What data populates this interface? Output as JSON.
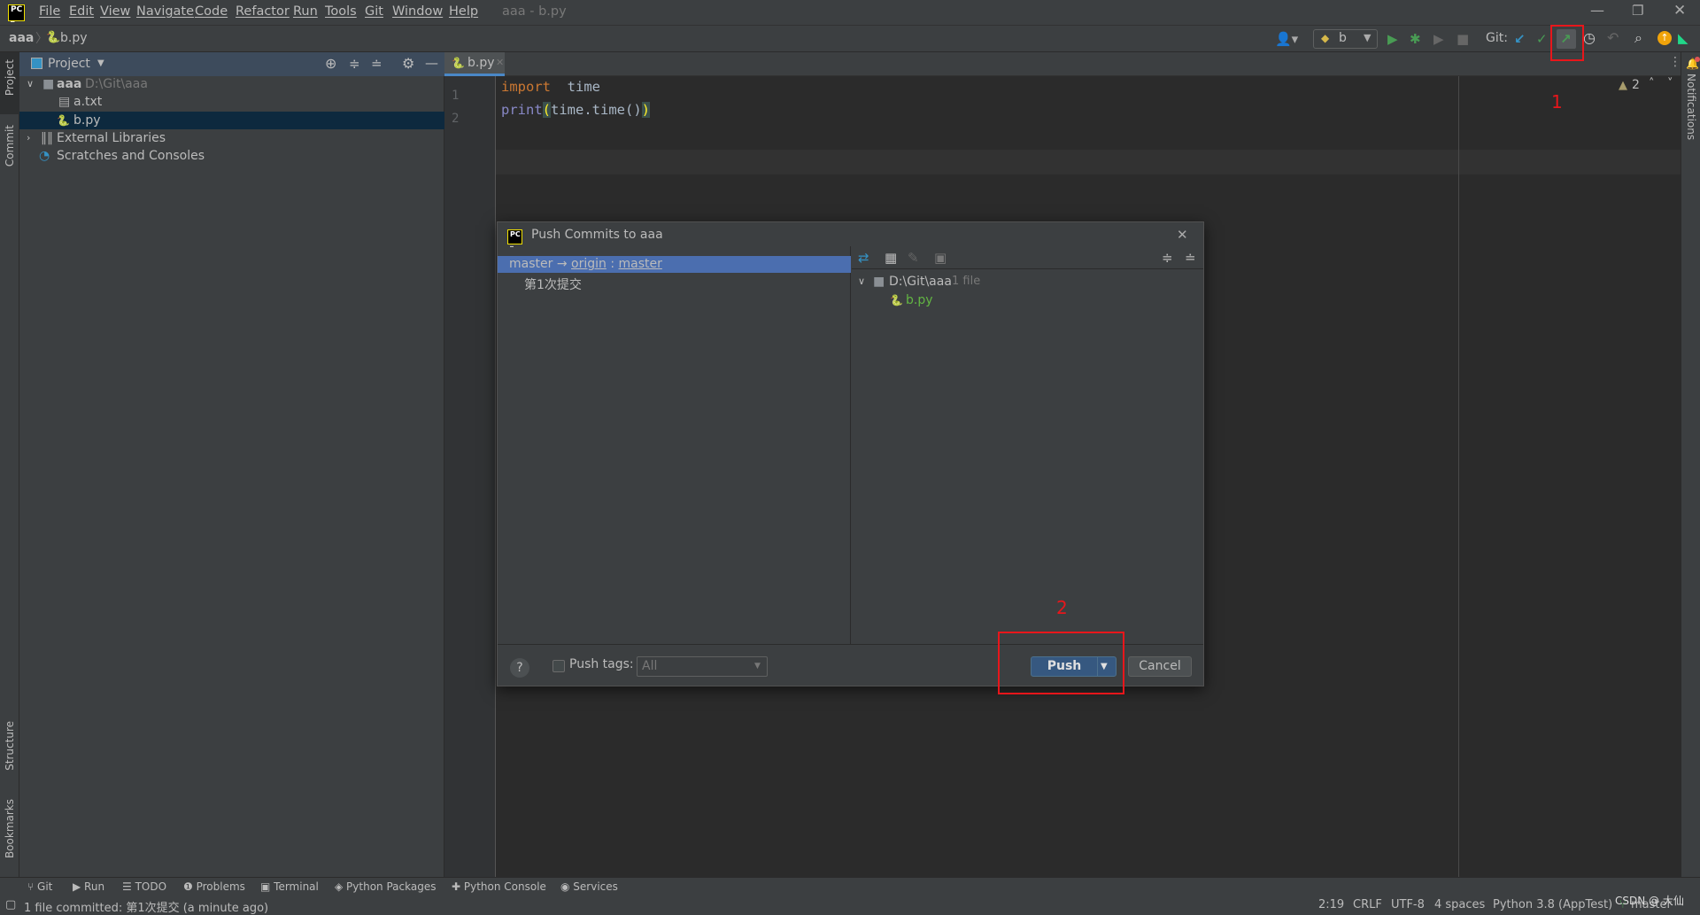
{
  "window": {
    "title": "aaa - b.py",
    "menu": [
      "File",
      "Edit",
      "View",
      "Navigate",
      "Code",
      "Refactor",
      "Run",
      "Tools",
      "Git",
      "Window",
      "Help"
    ],
    "controls": [
      "minimize",
      "restore",
      "close"
    ]
  },
  "navbar": {
    "project": "aaa",
    "file": "b.py"
  },
  "toolbar": {
    "run_config": "b",
    "git_label": "Git:",
    "icons": [
      "user-icon",
      "run-icon",
      "debug-icon",
      "coverage-icon",
      "stop-icon",
      "git-update-icon",
      "git-commit-icon",
      "git-push-icon",
      "history-icon",
      "rollback-icon",
      "search-icon",
      "ide-update-icon",
      "toolbox-icon"
    ]
  },
  "left_strip": {
    "project": "Project",
    "commit": "Commit",
    "structure": "Structure",
    "bookmarks": "Bookmarks"
  },
  "right_strip": {
    "notifications": "Notifications"
  },
  "project_panel": {
    "title": "Project",
    "tree": [
      {
        "name": "aaa",
        "path": "D:\\Git\\aaa"
      },
      {
        "name": "a.txt"
      },
      {
        "name": "b.py",
        "selected": true
      },
      {
        "name": "External Libraries"
      },
      {
        "name": "Scratches and Consoles"
      }
    ]
  },
  "editor": {
    "tab": "b.py",
    "lines": [
      {
        "num": "1",
        "kw": "import",
        "rest": "  time"
      },
      {
        "num": "2",
        "fn": "print",
        "p1": "(",
        "mid": "time.time()",
        "p2": ")"
      }
    ],
    "warnings": "2"
  },
  "dialog": {
    "title": "Push Commits to aaa",
    "branch": {
      "local": "master",
      "arrow": "→",
      "remote": "origin",
      "sep": ":",
      "remote_branch": "master"
    },
    "commit": "第1次提交",
    "tree_root": "D:\\Git\\aaa",
    "tree_count": "1 file",
    "file": "b.py",
    "push_tags_label": "Push tags:",
    "push_tags_checked": false,
    "push_tags_value": "All",
    "push_label": "Push",
    "cancel_label": "Cancel",
    "help": "?"
  },
  "annotations": {
    "one": "1",
    "two": "2",
    "color": "#e8161b"
  },
  "bottom_tools": [
    "Git",
    "Run",
    "TODO",
    "Problems",
    "Terminal",
    "Python Packages",
    "Python Console",
    "Services"
  ],
  "status": {
    "message": "1 file committed: 第1次提交 (a minute ago)",
    "position": "2:19",
    "line_sep": "CRLF",
    "encoding": "UTF-8",
    "indent": "4 spaces",
    "interpreter": "Python 3.8 (AppTest)",
    "branch": "master",
    "watermark": "CSDN @ 大仙"
  },
  "colors": {
    "keyword": "#cc7832",
    "builtin": "#8888c6",
    "selection": "#4b6eaf",
    "push_button": "#365880",
    "git_push": "#499c54"
  }
}
